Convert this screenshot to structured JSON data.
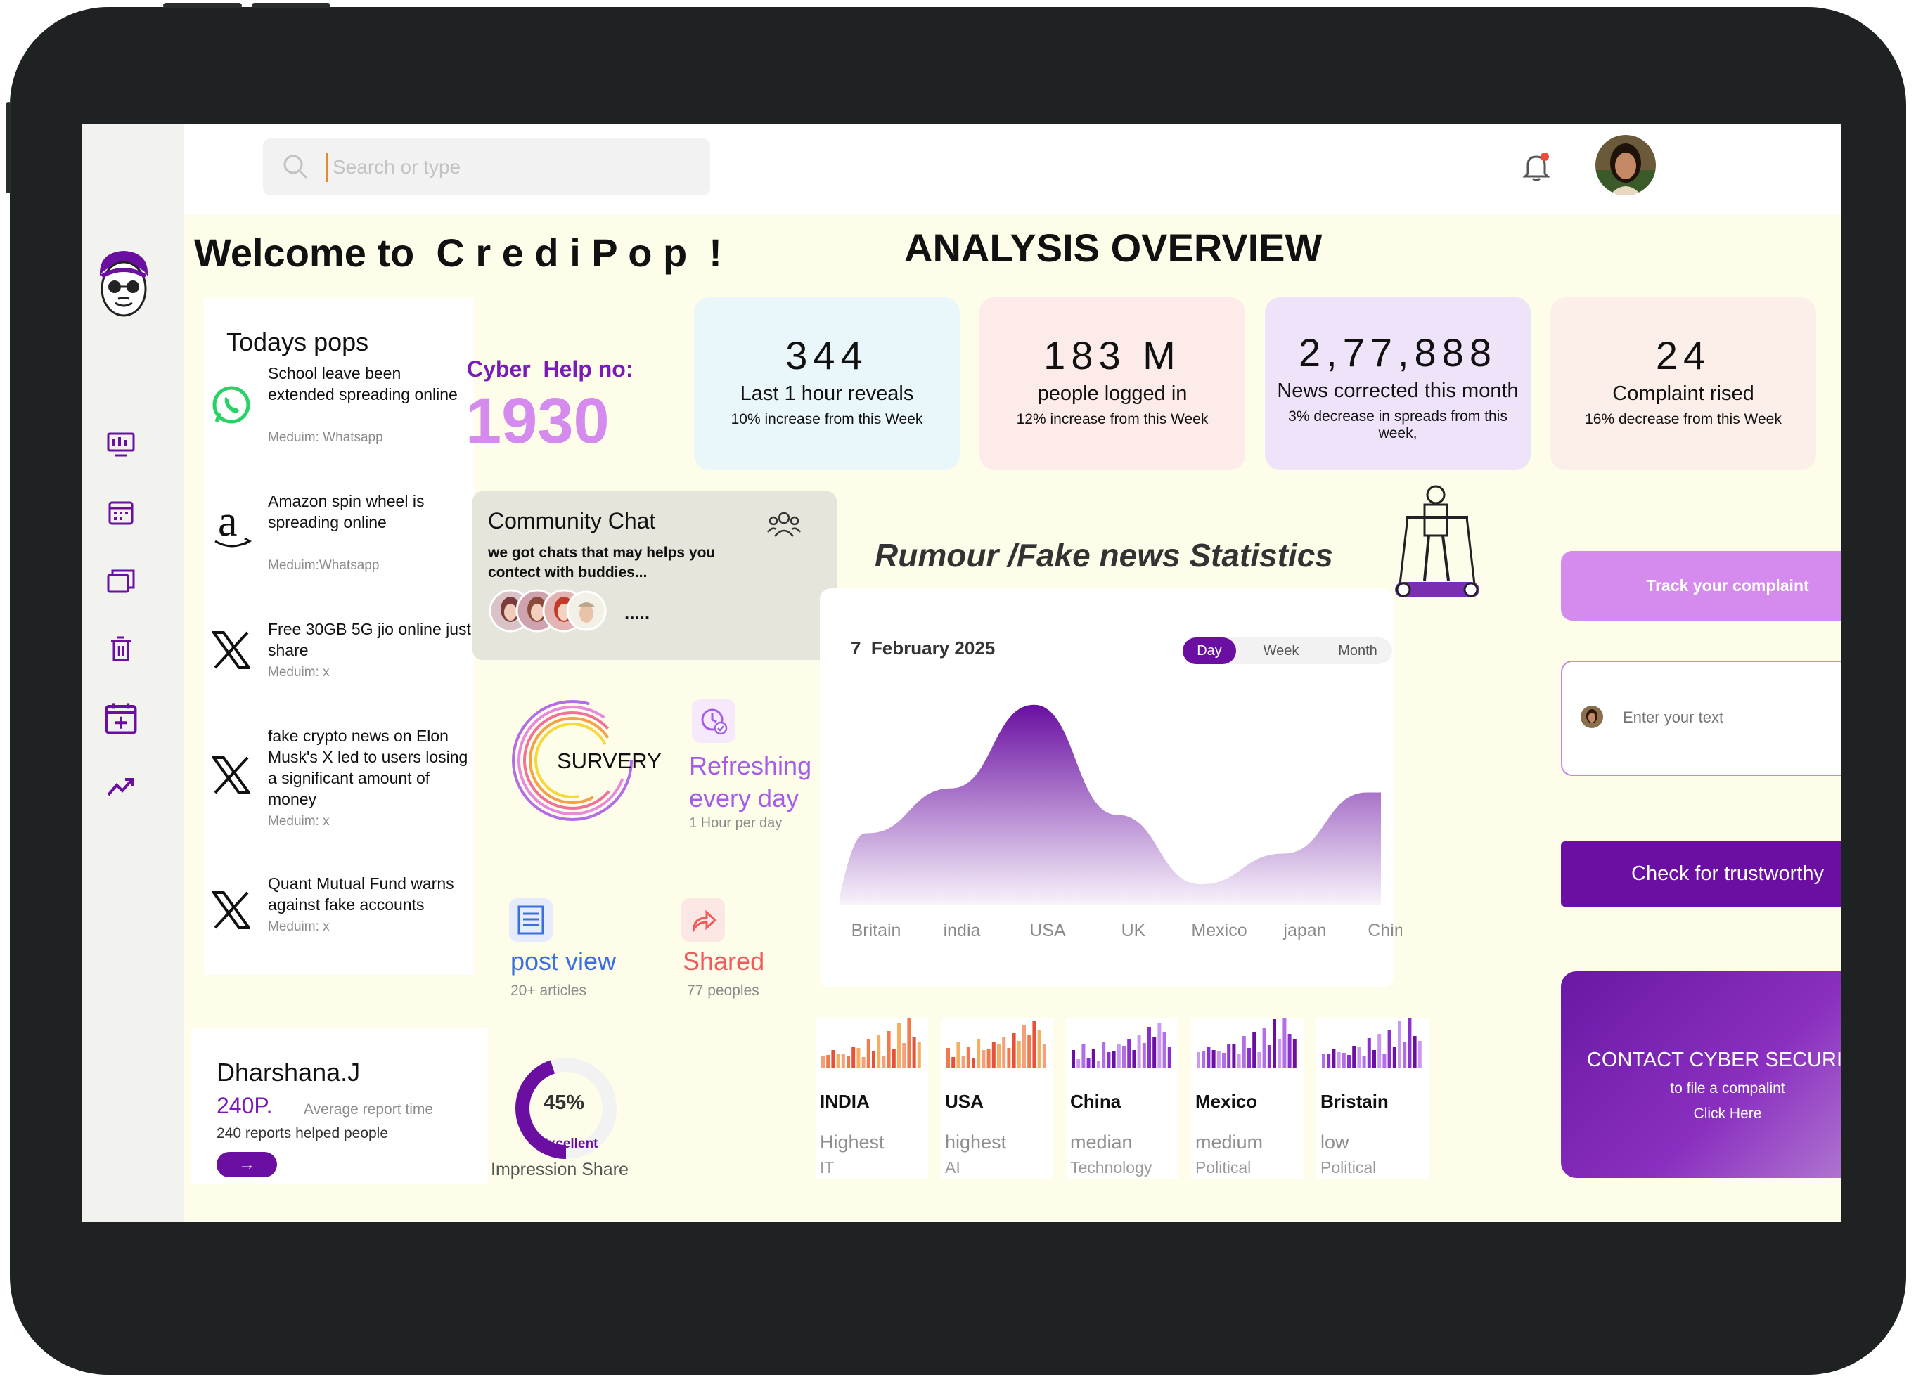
{
  "search": {
    "placeholder": "Search or type"
  },
  "welcome": "Welcome to  C r e d i P o p  !",
  "overview_title": "ANALYSIS OVERVIEW",
  "todays_pops": {
    "title": "Todays pops",
    "items": [
      {
        "title": "School leave been extended spreading online",
        "medium": "Meduim: Whatsapp",
        "icon": "whatsapp-icon"
      },
      {
        "title": "Amazon spin wheel is spreading online",
        "medium": "Meduim:Whatsapp",
        "icon": "amazon-icon"
      },
      {
        "title": "Free 30GB 5G jio online just share",
        "medium": "Meduim: x",
        "icon": "x-icon"
      },
      {
        "title": "fake crypto news on Elon Musk's X led to users losing a significant amount of money",
        "medium": "Meduim: x",
        "icon": "x-icon"
      },
      {
        "title": "Quant Mutual Fund warns against fake accounts",
        "medium": "Meduim: x",
        "icon": "x-icon"
      }
    ]
  },
  "cyber_help": {
    "label": "Cyber  Help no:",
    "number": "1930"
  },
  "stats": [
    {
      "num": "344",
      "label": "Last 1 hour reveals",
      "sub": "10% increase from this Week",
      "color": "#e9f7fb"
    },
    {
      "num": "183 M",
      "label": "people logged in",
      "sub": "12% increase from this Week",
      "color": "#fcebe9"
    },
    {
      "num": "2,77,888",
      "label": "News corrected this month",
      "sub": "3% decrease  in spreads from this week,",
      "color": "#efe3f9"
    },
    {
      "num": "24",
      "label": "Complaint rised",
      "sub": "16% decrease from this Week",
      "color": "#fcefe9"
    }
  ],
  "community": {
    "title": "Community Chat",
    "text": "we got  chats that may helps you  contect with buddies...",
    "more": "....."
  },
  "survey": {
    "label": "SURVERY",
    "refresh_title": "Refreshing every day",
    "refresh_sub": "1 Hour per day"
  },
  "post_view": {
    "title": "post view",
    "sub": "20+ articles"
  },
  "shared": {
    "title": "Shared",
    "sub": "77 peoples"
  },
  "profile": {
    "name": "Dharshana.J",
    "points": "240P.",
    "avg": "Average report time",
    "helped": "240 reports helped people",
    "arrow": "→"
  },
  "impression": {
    "percent": "45%",
    "rating": "Excellent",
    "label": "Impression Share",
    "value": 0.45
  },
  "stats_chart_title": "Rumour /Fake news Statistics",
  "chart_date": "7  February 2025",
  "chart_tabs": [
    "Day",
    "Week",
    "Month"
  ],
  "active_tab": "Day",
  "chart_data": {
    "type": "area",
    "categories": [
      "Britain",
      "india",
      "USA",
      "UK",
      "Mexico",
      "japan",
      "China"
    ],
    "values": [
      35,
      57,
      98,
      44,
      10,
      25,
      55
    ]
  },
  "countries": [
    {
      "name": "INDIA",
      "level": "Highest",
      "category": "IT",
      "palette": "warm"
    },
    {
      "name": "USA",
      "level": "highest",
      "category": "AI",
      "palette": "warm"
    },
    {
      "name": "China",
      "level": "median",
      "category": "Technology",
      "palette": "purple"
    },
    {
      "name": "Mexico",
      "level": "medium",
      "category": "Political",
      "palette": "purple"
    },
    {
      "name": "Bristain",
      "level": "low",
      "category": "Political",
      "palette": "purple"
    }
  ],
  "track_button": "Track your complaint",
  "input_placeholder": "Enter your text",
  "check_button": "Check for trustworthy",
  "contact": {
    "title": "CONTACT CYBER SECURITY",
    "sub": "to file a compalint",
    "cta": "Click Here"
  },
  "colors": {
    "brand_purple": "#6a0fa2",
    "light_purple": "#d58bee",
    "accent_violet": "#a55ce8",
    "red": "#f15a5a",
    "blue": "#3b6fe0"
  }
}
